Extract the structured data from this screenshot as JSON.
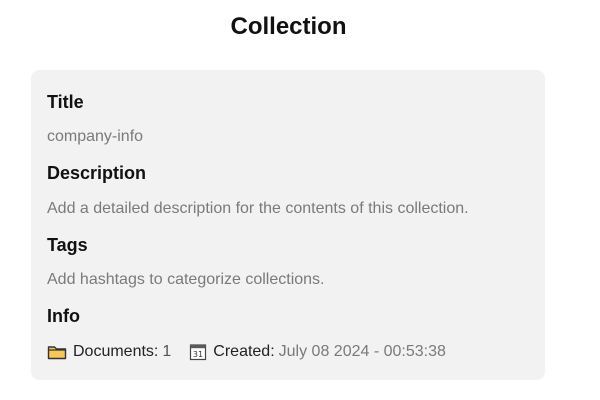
{
  "page": {
    "title": "Collection"
  },
  "card": {
    "title_label": "Title",
    "title_value": "company-info",
    "description_label": "Description",
    "description_value": "Add a detailed description for the contents of this collection.",
    "tags_label": "Tags",
    "tags_value": "Add hashtags to categorize collections.",
    "info_label": "Info",
    "info": {
      "documents_label": "Documents:",
      "documents_count": "1",
      "created_label": "Created:",
      "created_value": "July 08 2024 - 00:53:38",
      "calendar_icon_day": "31"
    }
  },
  "icons": {
    "documents": "folder-icon",
    "created": "calendar-icon"
  }
}
